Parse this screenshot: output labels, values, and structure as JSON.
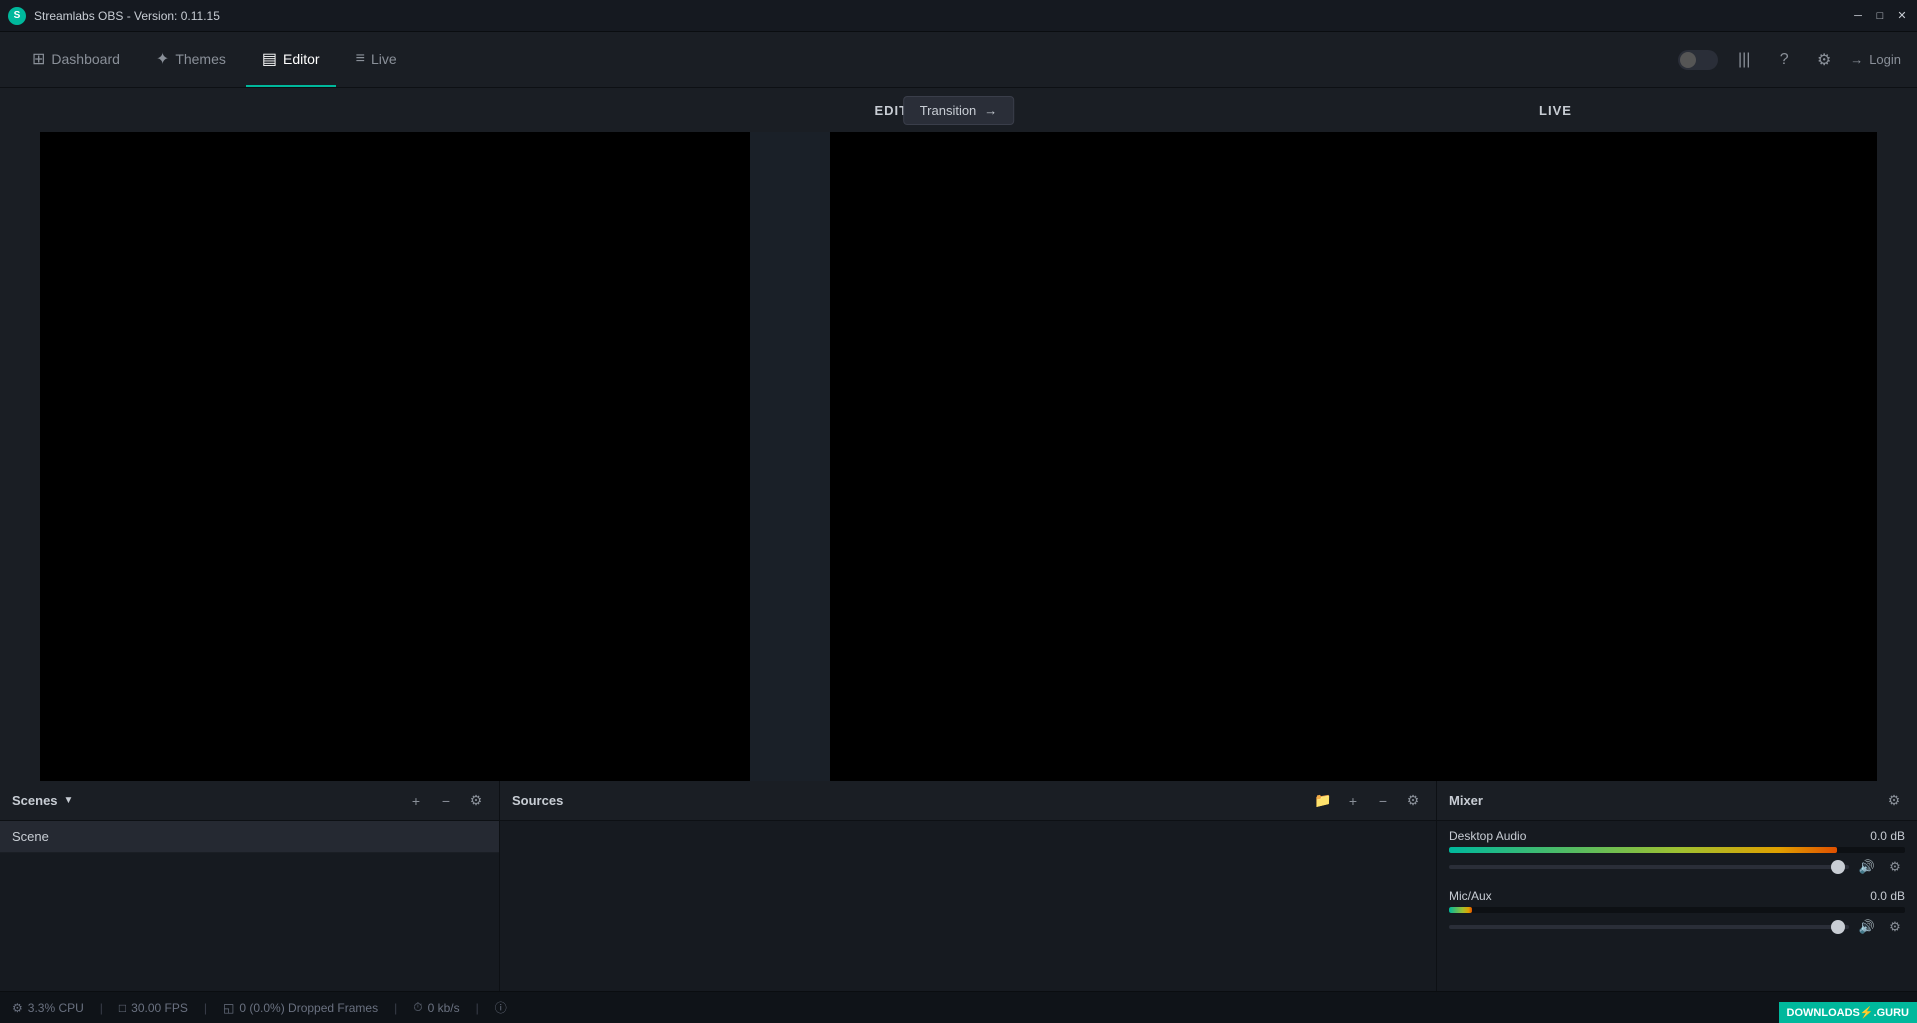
{
  "app": {
    "title": "Streamlabs OBS - Version: 0.11.15",
    "icon": "S"
  },
  "titlebar": {
    "minimize_label": "─",
    "maximize_label": "□",
    "close_label": "✕"
  },
  "nav": {
    "items": [
      {
        "id": "dashboard",
        "label": "Dashboard",
        "icon": "⊞",
        "active": false
      },
      {
        "id": "themes",
        "label": "Themes",
        "icon": "✦",
        "active": false
      },
      {
        "id": "editor",
        "label": "Editor",
        "icon": "▤",
        "active": true
      },
      {
        "id": "live",
        "label": "Live",
        "icon": "≡",
        "active": false
      }
    ],
    "right_icons": [
      "globe",
      "bars",
      "question",
      "gear",
      "login"
    ],
    "login_label": "Login"
  },
  "preview": {
    "edit_label": "EDIT",
    "live_label": "LIVE",
    "transition_label": "Transition",
    "transition_arrow": "→"
  },
  "scenes": {
    "title": "Scenes",
    "items": [
      {
        "name": "Scene"
      }
    ],
    "actions": {
      "add": "+",
      "remove": "−",
      "settings": "⚙"
    }
  },
  "sources": {
    "title": "Sources",
    "actions": {
      "folder": "📁",
      "add": "+",
      "remove": "−",
      "settings": "⚙"
    }
  },
  "mixer": {
    "title": "Mixer",
    "settings_icon": "⚙",
    "channels": [
      {
        "name": "Desktop Audio",
        "db": "0.0 dB",
        "meter_fill_pct": 85,
        "slider_thumb_pct": 95
      },
      {
        "name": "Mic/Aux",
        "db": "0.0 dB",
        "meter_fill_pct": 5,
        "slider_thumb_pct": 95
      }
    ]
  },
  "statusbar": {
    "cpu_icon": "⚙",
    "cpu_label": "3.3% CPU",
    "fps_icon": "□",
    "fps_label": "30.00 FPS",
    "dropped_icon": "◱",
    "dropped_label": "0 (0.0%) Dropped Frames",
    "bandwidth_icon": "⏱",
    "bandwidth_label": "0 kb/s",
    "info_icon": "ⓘ",
    "divider": "|",
    "watermark": "DOWNLOADS⚡.GURU"
  }
}
